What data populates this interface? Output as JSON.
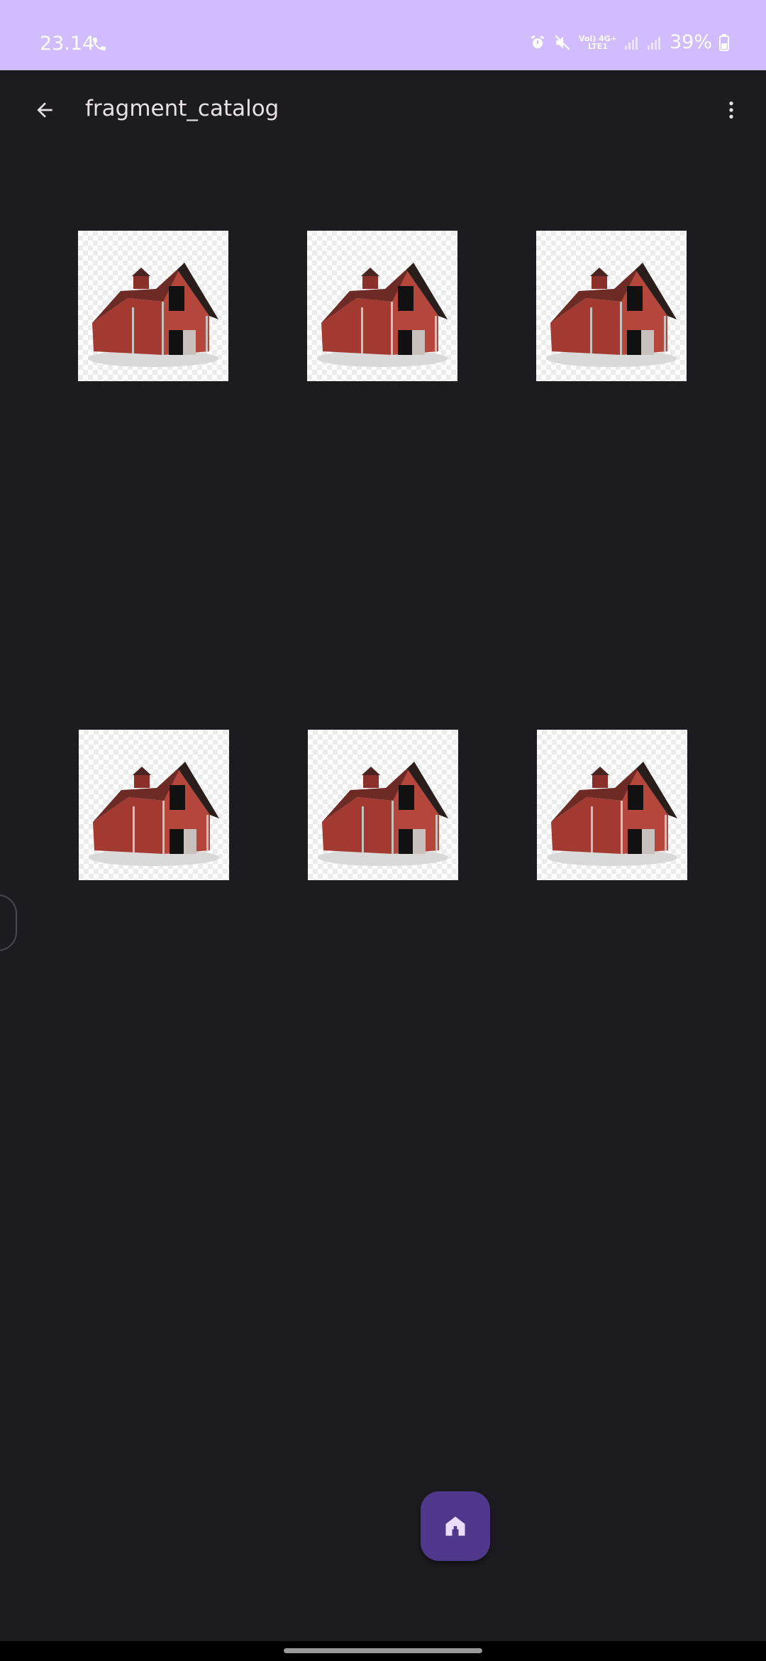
{
  "status_bar": {
    "time": "23.14",
    "battery": "39%",
    "network_top": "Vol) 4G+",
    "network_bottom": "LTE1"
  },
  "app_bar": {
    "title": "fragment_catalog"
  },
  "catalog": {
    "items": [
      {
        "alt": "barn"
      },
      {
        "alt": "barn"
      },
      {
        "alt": "barn"
      },
      {
        "alt": "barn"
      },
      {
        "alt": "barn"
      },
      {
        "alt": "barn"
      }
    ]
  },
  "icons": {
    "back": "arrow-back-icon",
    "menu": "more-vert-icon",
    "fab": "home-icon"
  },
  "colors": {
    "status_bar": "#d0bcfe",
    "background": "#1c1b20",
    "fab": "#4f378b"
  }
}
